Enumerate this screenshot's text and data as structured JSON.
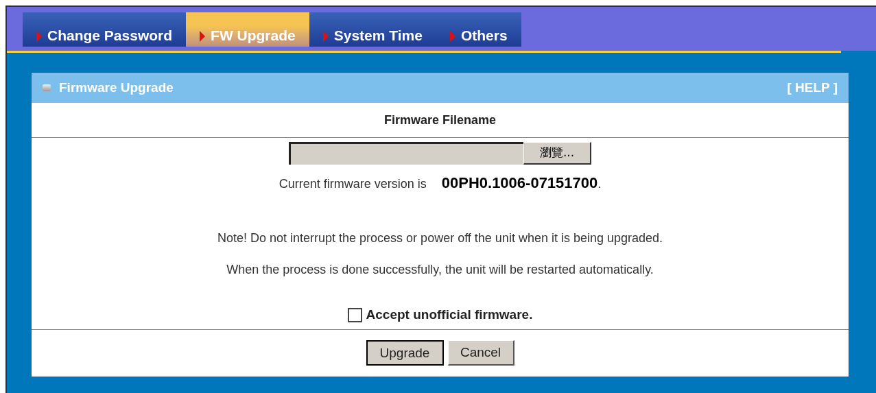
{
  "tabs": [
    {
      "label": "Change Password",
      "selected": false
    },
    {
      "label": "FW Upgrade",
      "selected": true
    },
    {
      "label": "System Time",
      "selected": false
    },
    {
      "label": "Others",
      "selected": false
    }
  ],
  "panel": {
    "title": "Firmware Upgrade",
    "help": "[ HELP ]",
    "section_heading": "Firmware Filename",
    "browse_button": "瀏覽...",
    "version_label": "Current firmware version is",
    "version": "00PH0.1006-07151700",
    "version_end": ".",
    "notes": [
      "Note! Do not interrupt the process or power off the unit when it is being upgraded.",
      "When the process is done successfully, the unit will be restarted automatically."
    ],
    "accept": {
      "label": "Accept unofficial firmware.",
      "checked": false
    },
    "buttons": [
      "Upgrade",
      "Cancel"
    ]
  }
}
